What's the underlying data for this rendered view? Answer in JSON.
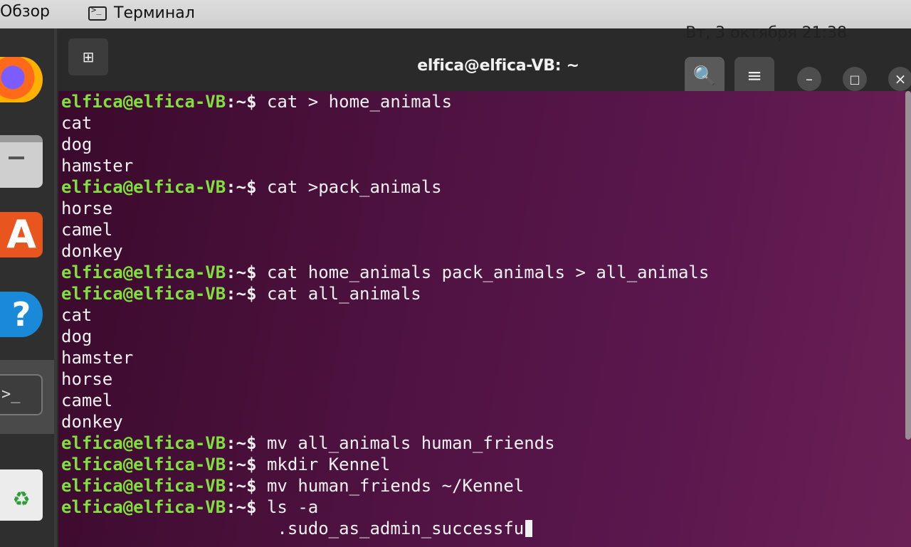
{
  "topbar": {
    "overview": "Обзор",
    "active_app": "Терминал",
    "active_app_icon": "terminal-icon",
    "clock": "Вт, 3 октября  21:38"
  },
  "dock": {
    "items": [
      {
        "name": "firefox",
        "icon": "firefox-icon"
      },
      {
        "name": "files",
        "icon": "files-icon"
      },
      {
        "name": "software",
        "icon": "software-center-icon",
        "glyph": "A"
      },
      {
        "name": "help",
        "icon": "help-icon",
        "glyph": "?"
      },
      {
        "name": "terminal",
        "icon": "terminal-icon",
        "glyph": ">_"
      },
      {
        "name": "trash",
        "icon": "trash-icon",
        "glyph": "♻"
      }
    ]
  },
  "window": {
    "title": "elfica@elfica-VB: ~",
    "new_tab_icon": "⊞",
    "search_icon": "🔍",
    "menu_icon": "≡",
    "minimize_icon": "–",
    "maximize_icon": "□",
    "close_icon": "×"
  },
  "terminal": {
    "prompt_user": "elfica@elfica-VB",
    "prompt_path": ":~$ ",
    "lines": [
      {
        "type": "cmd",
        "text": "cat > home_animals"
      },
      {
        "type": "out",
        "text": "cat"
      },
      {
        "type": "out",
        "text": "dog"
      },
      {
        "type": "out",
        "text": "hamster"
      },
      {
        "type": "cmd",
        "text": "cat >pack_animals"
      },
      {
        "type": "out",
        "text": "horse"
      },
      {
        "type": "out",
        "text": "camel"
      },
      {
        "type": "out",
        "text": "donkey"
      },
      {
        "type": "cmd",
        "text": "cat home_animals pack_animals > all_animals"
      },
      {
        "type": "cmd",
        "text": "cat all_animals"
      },
      {
        "type": "out",
        "text": "cat"
      },
      {
        "type": "out",
        "text": "dog"
      },
      {
        "type": "out",
        "text": "hamster"
      },
      {
        "type": "out",
        "text": "horse"
      },
      {
        "type": "out",
        "text": "camel"
      },
      {
        "type": "out",
        "text": "donkey"
      },
      {
        "type": "cmd",
        "text": "mv all_animals human_friends"
      },
      {
        "type": "cmd",
        "text": "mkdir Kennel"
      },
      {
        "type": "cmd",
        "text": "mv human_friends ~/Kennel"
      },
      {
        "type": "cmd",
        "text": "ls -a"
      },
      {
        "type": "out",
        "text": "                     .sudo_as_admin_successfu"
      }
    ]
  },
  "colors": {
    "prompt_user": "#7fe03e",
    "terminal_bg": "#4e1240",
    "text": "#f1f1f1"
  }
}
